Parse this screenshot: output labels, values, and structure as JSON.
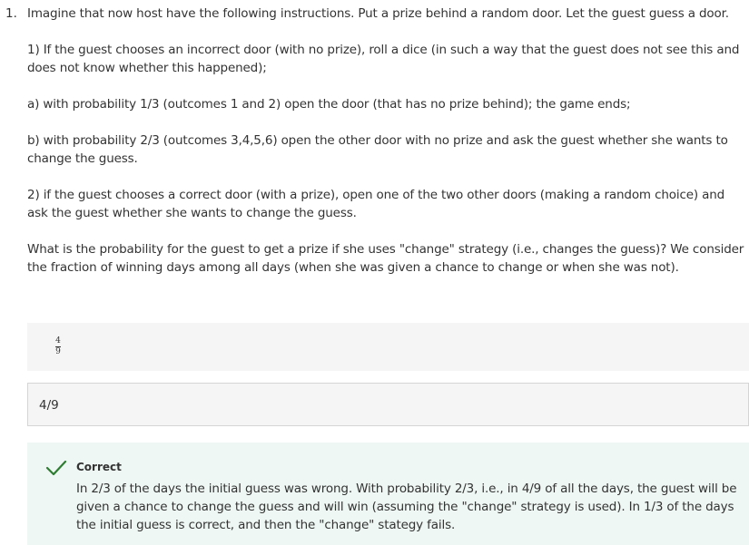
{
  "question": {
    "number": "1.",
    "paragraphs": [
      "Imagine that now host have the following instructions. Put a prize behind a random door. Let the guest guess a door.",
      "1) If the guest chooses an incorrect door (with no prize), roll a dice (in such a way that the guest does not see this and does not know whether this happened);",
      "a) with probability 1/3 (outcomes 1 and 2) open the door (that has no prize behind); the game ends;",
      "b) with probability 2/3 (outcomes 3,4,5,6) open the other door with no prize and ask the guest whether she wants to change the guess.",
      "2) if the guest chooses a correct door (with a prize), open one of the two other doors (making a random choice) and ask the guest whether she wants to change the guess.",
      "What is the probability for the guest to get a prize if she uses \"change\" strategy (i.e., changes the guess)? We consider the fraction of winning days among all days (when she was given a chance to change or when she was not)."
    ]
  },
  "preview": {
    "numerator": "4",
    "denominator": "9"
  },
  "answer": {
    "value": "4/9"
  },
  "feedback": {
    "status": "Correct",
    "status_color": "#2e7d32",
    "icon": "checkmark-icon",
    "text": "In 2/3 of the days the initial guess was wrong. With probability 2/3, i.e., in 4/9 of all the days, the guest will be given a chance to change the guess and will win (assuming the \"change\" strategy is used). In 1/3 of the days the initial guess is correct, and then the \"change\" stategy fails."
  }
}
